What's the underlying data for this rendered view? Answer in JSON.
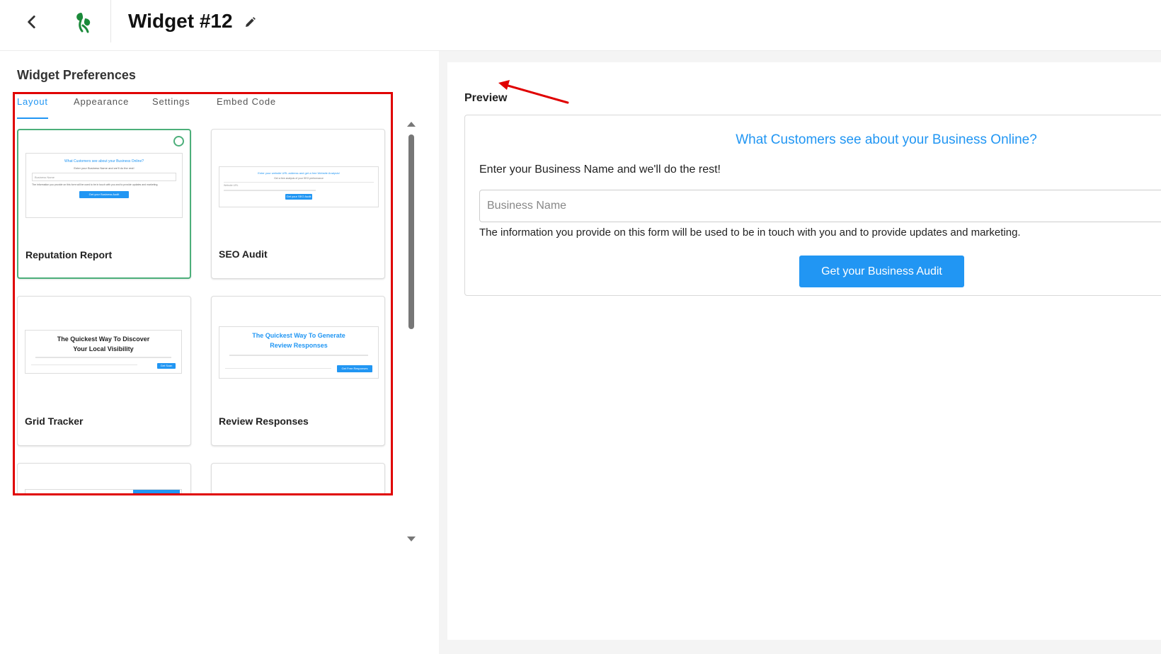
{
  "header": {
    "title": "Widget #12",
    "back_icon": "chevron-left-icon",
    "logo_icon": "leaf-logo-icon",
    "edit_icon": "pencil-icon"
  },
  "preferences": {
    "title": "Widget Preferences",
    "tabs": [
      {
        "label": "Layout",
        "active": true
      },
      {
        "label": "Appearance",
        "active": false
      },
      {
        "label": "Settings",
        "active": false
      },
      {
        "label": "Embed Code",
        "active": false
      }
    ],
    "cards": [
      {
        "label": "Reputation Report",
        "selected": true,
        "thumb_heading": "What Customers see about your Business Online?",
        "thumb_sub": "Enter your Business Name and we'll do the rest!",
        "thumb_input": "Business Name",
        "thumb_note": "The information you provide on this form will be used to be in touch with you and to provide updates and marketing.",
        "thumb_button": "Get your Business Audit"
      },
      {
        "label": "SEO Audit",
        "selected": false,
        "thumb_heading": "Enter your website URL address and get a free Website Analysis!",
        "thumb_sub": "Get a free analysis of your SEO performance",
        "thumb_input": "Website URL",
        "thumb_button": "Get your SEO Audit"
      },
      {
        "label": "Grid Tracker",
        "selected": false,
        "thumb_heading_1": "The Quickest Way To Discover",
        "thumb_heading_2": "Your Local Visibility",
        "thumb_button": "Get Scan"
      },
      {
        "label": "Review Responses",
        "selected": false,
        "thumb_heading_1": "The Quickest Way To Generate",
        "thumb_heading_2": "Review Responses",
        "thumb_button": "Get Free Responses"
      }
    ]
  },
  "preview": {
    "label": "Preview",
    "heading": "What Customers see about your Business Online?",
    "subtitle": "Enter your Business Name and we'll do the rest!",
    "input_placeholder": "Business Name",
    "note": "The information you provide on this form will be used to be in touch with you and to provide updates and marketing.",
    "button_label": "Get your Business Audit"
  },
  "colors": {
    "accent": "#2196f3",
    "selected": "#4caf7a",
    "annotation": "#e00000"
  }
}
